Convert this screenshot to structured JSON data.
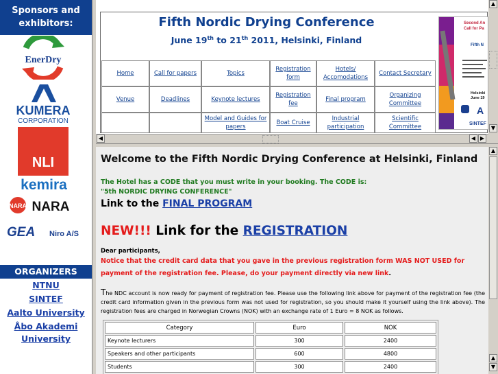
{
  "sidebar": {
    "sponsors_heading_line1": "Sponsors and",
    "sponsors_heading_line2": "exhibitors:",
    "sponsors": [
      {
        "name": "EnerDry"
      },
      {
        "name": "KUMERA",
        "sub": "CORPORATION"
      },
      {
        "name": "NLI"
      },
      {
        "name": "kemira"
      },
      {
        "name": "NARA"
      },
      {
        "name": "GEA",
        "sub": "Niro A/S"
      }
    ],
    "organizers_heading": "ORGANIZERS",
    "organizers": [
      "NTNU",
      "SINTEF",
      "Aalto University",
      "Åbo Akademi",
      "University"
    ]
  },
  "header": {
    "title": "Fifth Nordic Drying Conference",
    "date_pre": "June 19",
    "date_sup1": "th",
    "date_mid": " to 21",
    "date_sup2": "th",
    "date_post": "  2011, Helsinki, Finland",
    "nav": [
      [
        "Home",
        "Call for papers",
        "Topics",
        "Registration form",
        "Hotels/ Accomodations",
        "Contact Secretary"
      ],
      [
        "Venue",
        "Deadlines",
        "Keynote lectures",
        "Registration fee",
        "Final program",
        "Organizing Committee"
      ],
      [
        "",
        "",
        "Model and Guides for papers",
        "Boat Cruise",
        "Industrial participation",
        "Scientific Committee"
      ]
    ],
    "ad": {
      "line1": "Second An",
      "line2": "Call for Pa",
      "line3": "Fifth N",
      "line4": "Helsinki",
      "line5": "June 19",
      "line6": "A",
      "line7": "SINTEF"
    }
  },
  "main": {
    "welcome": "Welcome to the Fifth Nordic Drying Conference at Helsinki, Finland",
    "hotel_code_line1": "The Hotel has a CODE that you must write in your booking. The CODE is:",
    "hotel_code_line2": "\"5th NORDIC DRYING CONFERENCE\"",
    "final_prefix": "Link to the ",
    "final_link": "FINAL PROGRAM",
    "new_prefix": "NEW!!!",
    "new_middle": " Link for the ",
    "new_link": "REGISTRATION",
    "dear": "Dear participants,",
    "notice_text": "Notice that the credit card data that you gave in the previous registration form WAS NOT USED for payment of the registration fee. Please, do your payment directly via new link",
    "notice_end": ".",
    "para_cap": "T",
    "para_text": "he NDC account is now ready for payment of registration fee. Please use the following link above for payment of the registration fee (the credit card information given in the previous form was not used for registration, so you should make it yourself using the link above). The registration fees are charged in Norwegian Crowns (NOK) with an exchange rate of 1 Euro = 8 NOK as follows.",
    "fees_table": {
      "headers": [
        "Category",
        "Euro",
        "NOK"
      ],
      "rows": [
        [
          "Keynote lecturers",
          "300",
          "2400"
        ],
        [
          "Speakers and other participants",
          "600",
          "4800"
        ],
        [
          "Students",
          "300",
          "2400"
        ]
      ]
    }
  },
  "colors": {
    "brand_blue": "#10408f",
    "link_blue": "#1a3fa6",
    "alert_red": "#e41b1b",
    "green": "#1f7a1f"
  }
}
